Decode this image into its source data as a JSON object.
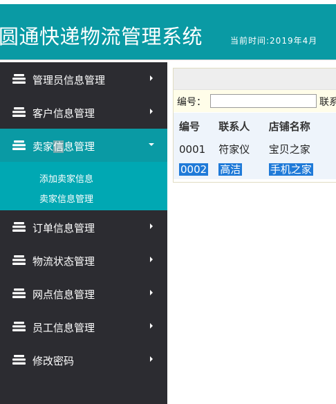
{
  "header": {
    "title": "圆通快递物流管理系统",
    "time_text": "当前时间:2019年4月"
  },
  "sidebar": {
    "items": [
      {
        "label": "管理员信息管理"
      },
      {
        "label": "客户信息管理"
      },
      {
        "label": "卖家信息管理"
      },
      {
        "label": "订单信息管理"
      },
      {
        "label": "物流状态管理"
      },
      {
        "label": "网点信息管理"
      },
      {
        "label": "员工信息管理"
      },
      {
        "label": "修改密码"
      }
    ],
    "active_part1": "卖家",
    "active_part2": "信",
    "active_part3": "息管理",
    "submenu": [
      {
        "label": "添加卖家信息"
      },
      {
        "label": "卖家信息管理"
      }
    ]
  },
  "search": {
    "id_label": "编号：",
    "id_value": "",
    "contact_label": "联系"
  },
  "table": {
    "headers": [
      "编号",
      "联系人",
      "店铺名称"
    ],
    "rows": [
      [
        "0001",
        "符家仪",
        "宝贝之家"
      ],
      [
        "0002",
        "高洁",
        "手机之家"
      ]
    ]
  },
  "colors": {
    "header_bg": "#0a9aa4",
    "sidebar_bg": "#2c2c31",
    "active_bg": "#0a9aa4",
    "selection": "#1f7ad8"
  }
}
